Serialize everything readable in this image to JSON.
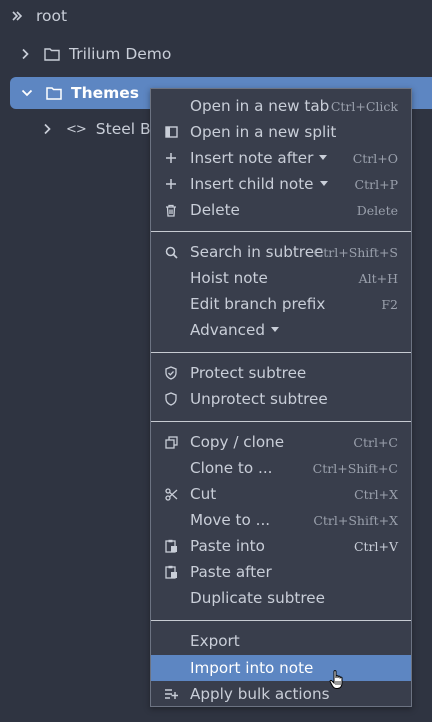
{
  "tree": {
    "root": "root",
    "demo": "Trilium Demo",
    "themes": "Themes",
    "steel": "Steel Blu"
  },
  "menu": {
    "items": [
      {
        "label": "Open in a new tab",
        "shortcut": "Ctrl+Click",
        "icon": "none"
      },
      {
        "label": "Open in a new split",
        "icon": "split-icon"
      },
      {
        "label": "Insert note after",
        "shortcut": "Ctrl+O",
        "icon": "plus-icon",
        "submenu": true
      },
      {
        "label": "Insert child note",
        "shortcut": "Ctrl+P",
        "icon": "plus-icon",
        "submenu": true
      },
      {
        "label": "Delete",
        "shortcut": "Delete",
        "icon": "trash-icon"
      },
      {
        "label": "Search in subtree",
        "shortcut": "Ctrl+Shift+S",
        "icon": "search-icon"
      },
      {
        "label": "Hoist note",
        "shortcut": "Alt+H",
        "icon": "none"
      },
      {
        "label": "Edit branch prefix",
        "shortcut": "F2",
        "icon": "none"
      },
      {
        "label": "Advanced",
        "icon": "none",
        "submenu": true
      },
      {
        "label": "Protect subtree",
        "icon": "shield-check-icon"
      },
      {
        "label": "Unprotect subtree",
        "icon": "shield-icon"
      },
      {
        "label": "Copy / clone",
        "shortcut": "Ctrl+C",
        "icon": "copy-icon"
      },
      {
        "label": "Clone to ...",
        "shortcut": "Ctrl+Shift+C",
        "icon": "none"
      },
      {
        "label": "Cut",
        "shortcut": "Ctrl+X",
        "icon": "scissors-icon"
      },
      {
        "label": "Move to ...",
        "shortcut": "Ctrl+Shift+X",
        "icon": "none"
      },
      {
        "label": "Paste into",
        "shortcut": "Ctrl+V",
        "icon": "paste-icon"
      },
      {
        "label": "Paste after",
        "icon": "paste-icon"
      },
      {
        "label": "Duplicate subtree",
        "icon": "none"
      },
      {
        "label": "Export",
        "icon": "none"
      },
      {
        "label": "Import into note",
        "icon": "none",
        "active": true
      },
      {
        "label": "Apply bulk actions",
        "icon": "bulk-actions-icon"
      }
    ]
  },
  "colors": {
    "background": "#2f3441",
    "menu_bg": "#393e4c",
    "accent": "#5d86c2",
    "text": "#c9ced8"
  }
}
